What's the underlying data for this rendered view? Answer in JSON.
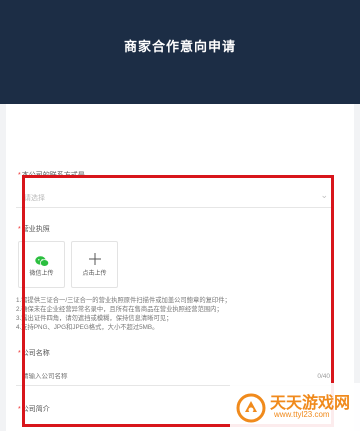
{
  "header": {
    "title": "商家合作意向申请"
  },
  "form": {
    "field_contact": {
      "label": "本公司的联系方式是",
      "placeholder": "请选择"
    },
    "field_license": {
      "label": "营业执照",
      "upload_wechat": "微信上传",
      "upload_click": "点击上传",
      "notes": [
        "1.需提供三证合一/三证合一的营业执照原件扫描件或加盖公司鲍章的复印件；",
        "2.确保未在企业经营异常名录中，且所有在售商品在营业执照经营范围内；",
        "3.露出证件四角，请勿遮挡或模糊，保持信息清晰可见；",
        "4.支持PNG、JPG和JPEG格式，大小不超过5MB。"
      ]
    },
    "field_company": {
      "label": "公司名称",
      "placeholder": "请输入公司名称",
      "counter": "0/40"
    },
    "field_intro": {
      "label": "公司简介"
    }
  },
  "watermark": {
    "title": "天天游戏网",
    "url": "www.ttyl23.com"
  },
  "colors": {
    "header_bg": "#1c2d45",
    "highlight": "#d8151b",
    "wechat": "#2bbf3f",
    "watermark": "#f08a1c"
  },
  "icons": {
    "select_arrow": "chevron-down-icon",
    "wechat": "wechat-icon",
    "upload": "plus-icon",
    "watermark_logo": "logo-icon"
  }
}
